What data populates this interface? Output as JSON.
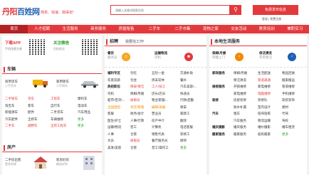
{
  "header": {
    "logo_red": "丹阳",
    "logo_blue": "百姓网",
    "slogan": "简单、快速、搞得定!",
    "search_placeholder": "请输入关键词搜索信息",
    "search_icon_glyph": "⚲",
    "post_button": "免费发布信息",
    "login": "登录 | 免费注册"
  },
  "nav": [
    "首页",
    "人才招聘",
    "生活服务",
    "商务服务",
    "房屋租售",
    "二手车",
    "二手市集",
    "宠物之家",
    "交友活动",
    "教育培训",
    "兼职实习"
  ],
  "left": {
    "app": {
      "title": "下载APP",
      "sub": "手机找更方便"
    },
    "wechat": {
      "title": "关注微信",
      "sub": "扫码关注"
    },
    "vehicles": {
      "title": "车辆",
      "used_car": {
        "title": "商用货车",
        "sub": "二手货车"
      },
      "family_car": {
        "title": "家用轿车",
        "sub": "二手轿车"
      },
      "rows": [
        [
          "二手轿车",
          "货车",
          "工程车",
          "摩托车"
        ],
        [
          "淘宝车",
          "客车",
          "自行车",
          "电动车"
        ],
        [
          "新能源车",
          "配件",
          "二手货车",
          "汽车用品"
        ],
        [
          "汽车配件",
          "全新车",
          "车辆维修",
          "更多"
        ],
        [
          "二手车",
          "越野车",
          "全新工程车",
          "更多"
        ]
      ]
    },
    "house": {
      "title": "房产",
      "items": [
        {
          "title": "二手房出售",
          "sub": "更多房源"
        },
        {
          "title": "新房好房",
          "sub": "精选好房"
        }
      ]
    }
  },
  "middle": {
    "title": "招聘",
    "subtitle": "我要找工作!",
    "featured": [
      {
        "title": "餐饮",
        "sub": "服务员"
      },
      {
        "title": "运输物流",
        "sub": "司机"
      },
      {
        "title": "普工",
        "sub": "操作工"
      }
    ],
    "rows": [
      [
        "福利专区",
        "包吃",
        "五险一金",
        "交通补助"
      ],
      [
        "年底双薪",
        "包住",
        "周末双休",
        "餐补"
      ],
      [
        "热招职位",
        "保安/保洁",
        "工人/技工",
        "汽车美容/..."
      ],
      [
        "司机",
        "保姆/月嫂",
        "店长/店员",
        "快递员"
      ],
      [
        "超市/百货/...",
        "收银员",
        "物业管理/...",
        "行政/后勤"
      ],
      [
        "全国直招",
        "淘宝/客服",
        "编辑/美编",
        "保安"
      ],
      [
        "客服",
        "财务/会计",
        "营业员",
        "家政工"
      ],
      [
        "医生/护士",
        "人事/行政",
        "房产中介",
        "翻译"
      ],
      [
        "运输/物流",
        "普工",
        "计算机",
        "电话客服"
      ],
      [
        "人事",
        "仓管",
        "销售代表",
        "装修工"
      ],
      [
        "文员",
        "收银员",
        "餐厅服务员",
        "厨师"
      ],
      [
        "美发/美容",
        "仓管",
        "普工/操作工",
        "更多"
      ]
    ]
  },
  "right": {
    "title": "本地生活服务",
    "featured": [
      {
        "title": "保姆/月嫂",
        "sub": "阿姨上门"
      },
      {
        "title": "保洁清洗",
        "sub": "开荒保洁"
      }
    ],
    "rows": [
      [
        "家政服务",
        "保姆/月嫂",
        "生活配送",
        "物品回收"
      ],
      [
        "",
        "保洁清洗",
        "管道疏通",
        "搬家搬运"
      ],
      [
        "维修服务",
        "开锁维修",
        "家电维修",
        "管道维修"
      ],
      [
        "",
        "家电维修",
        "电脑维修",
        "手机维修"
      ],
      [
        "装修",
        "房屋装修",
        "装修队",
        "软装装饰"
      ],
      [
        "",
        "防水补漏",
        "室内设计",
        "建材"
      ],
      [
        "汽车",
        "租车",
        "陪驾陪练",
        "代驾"
      ],
      [
        "",
        "汽车服务",
        "物流运输",
        "驾校"
      ],
      [
        "婚庆摄影",
        "婚庆服务",
        "婚纱摄影",
        "婚车租赁"
      ],
      [
        "搬家服务",
        "搬家服务",
        "居民搬家",
        "更多"
      ]
    ]
  },
  "colors": {
    "brand_red": "#e4393c",
    "brand_blue": "#1f5fb3",
    "green": "#2a9d2a",
    "orange": "#f08a00"
  },
  "icons": [
    "search-icon",
    "qr-code-icon",
    "truck-icon",
    "car-icon",
    "house-icon",
    "chef-icon",
    "delivery-icon",
    "worker-icon",
    "nanny-icon",
    "cleaner-icon"
  ]
}
